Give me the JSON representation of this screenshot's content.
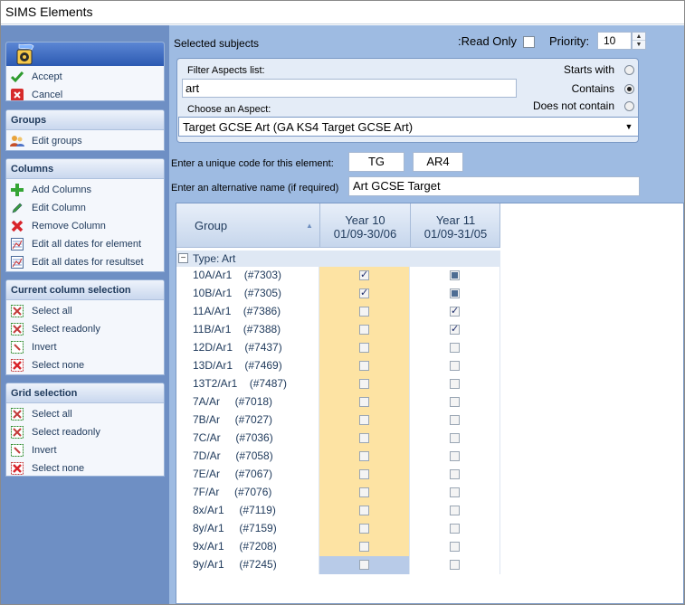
{
  "window": {
    "title": "SIMS Elements"
  },
  "taskpane": {
    "actions": [
      {
        "label": "Accept",
        "icon": "check-icon"
      },
      {
        "label": "Cancel",
        "icon": "cancel-icon"
      }
    ],
    "groups_section": {
      "title": "Groups",
      "items": [
        {
          "label": "Edit groups",
          "icon": "users-icon"
        }
      ]
    },
    "columns_section": {
      "title": "Columns",
      "items": [
        {
          "label": "Add Columns",
          "icon": "add-icon"
        },
        {
          "label": "Edit Column",
          "icon": "pencil-icon"
        },
        {
          "label": "Remove Column",
          "icon": "remove-icon"
        },
        {
          "label": "Edit all dates for element",
          "icon": "calendar-icon"
        },
        {
          "label": "Edit all dates for resultset",
          "icon": "calendar-icon"
        }
      ]
    },
    "column_selection_section": {
      "title": "Current column selection",
      "items": [
        {
          "label": "Select all",
          "icon": "select-all-icon"
        },
        {
          "label": "Select readonly",
          "icon": "select-readonly-icon"
        },
        {
          "label": "Invert",
          "icon": "invert-icon"
        },
        {
          "label": "Select none",
          "icon": "select-none-icon"
        }
      ]
    },
    "grid_selection_section": {
      "title": "Grid selection",
      "items": [
        {
          "label": "Select all",
          "icon": "select-all-icon"
        },
        {
          "label": "Select readonly",
          "icon": "select-readonly-icon"
        },
        {
          "label": "Invert",
          "icon": "invert-icon"
        },
        {
          "label": "Select none",
          "icon": "select-none-icon"
        }
      ]
    }
  },
  "main": {
    "selected_subjects_label": "Selected subjects",
    "read_only_label": ":Read Only",
    "read_only_checked": false,
    "priority_label": "Priority:",
    "priority_value": "10",
    "filter_label": "Filter Aspects list:",
    "filter_value": "art",
    "match_options": [
      {
        "label": "Starts with",
        "selected": false
      },
      {
        "label": "Contains",
        "selected": true
      },
      {
        "label": "Does not contain",
        "selected": false
      }
    ],
    "choose_aspect_label": "Choose an Aspect:",
    "aspect_value": "Target GCSE Art (GA KS4 Target GCSE Art)",
    "unique_code_label": "Enter a unique code for this element:",
    "unique_code_1": "TG",
    "unique_code_2": "AR4",
    "alt_name_label": "Enter an alternative name (if required)",
    "alt_name_value": "Art GCSE Target"
  },
  "grid": {
    "group_header": "Group",
    "columns": [
      {
        "line1": "Year 10",
        "line2": "01/09-30/06"
      },
      {
        "line1": "Year 11",
        "line2": "01/09-31/05"
      }
    ],
    "type_row": "Type:  Art",
    "rows": [
      {
        "group": "10A/Ar1    (#7303)",
        "y10": "checked",
        "y11": "indeterminate"
      },
      {
        "group": "10B/Ar1    (#7305)",
        "y10": "checked",
        "y11": "indeterminate"
      },
      {
        "group": "11A/Ar1    (#7386)",
        "y10": "unchecked",
        "y11": "checked"
      },
      {
        "group": "11B/Ar1    (#7388)",
        "y10": "unchecked",
        "y11": "checked"
      },
      {
        "group": "12D/Ar1    (#7437)",
        "y10": "unchecked",
        "y11": "unchecked"
      },
      {
        "group": "13D/Ar1    (#7469)",
        "y10": "unchecked",
        "y11": "unchecked"
      },
      {
        "group": "13T2/Ar1    (#7487)",
        "y10": "unchecked",
        "y11": "unchecked"
      },
      {
        "group": "7A/Ar     (#7018)",
        "y10": "unchecked",
        "y11": "unchecked"
      },
      {
        "group": "7B/Ar     (#7027)",
        "y10": "unchecked",
        "y11": "unchecked"
      },
      {
        "group": "7C/Ar     (#7036)",
        "y10": "unchecked",
        "y11": "unchecked"
      },
      {
        "group": "7D/Ar     (#7058)",
        "y10": "unchecked",
        "y11": "unchecked"
      },
      {
        "group": "7E/Ar     (#7067)",
        "y10": "unchecked",
        "y11": "unchecked"
      },
      {
        "group": "7F/Ar     (#7076)",
        "y10": "unchecked",
        "y11": "unchecked"
      },
      {
        "group": "8x/Ar1     (#7119)",
        "y10": "unchecked",
        "y11": "unchecked"
      },
      {
        "group": "8y/Ar1     (#7159)",
        "y10": "unchecked",
        "y11": "unchecked"
      },
      {
        "group": "9x/Ar1     (#7208)",
        "y10": "unchecked",
        "y11": "unchecked"
      },
      {
        "group": "9y/Ar1     (#7245)",
        "y10": "unchecked",
        "y11": "unchecked"
      }
    ]
  },
  "colors": {
    "accent": "#3568b0",
    "highlight": "#fde3a3",
    "selection": "#b8cbe8"
  }
}
